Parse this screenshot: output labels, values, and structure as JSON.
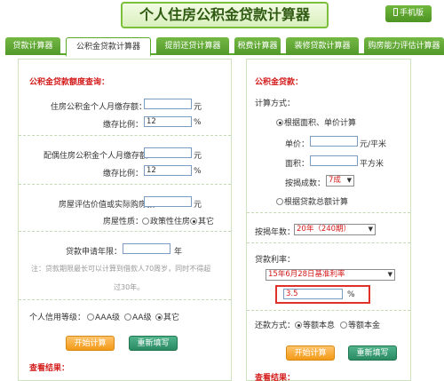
{
  "header": {
    "title": "个人住房公积金贷款计算器",
    "mobile_label": "手机版"
  },
  "tabs": [
    {
      "label": "贷款计算器"
    },
    {
      "label": "公积金贷款计算器"
    },
    {
      "label": "提前还贷计算器"
    },
    {
      "label": "税费计算器"
    },
    {
      "label": "装修贷款计算器"
    },
    {
      "label": "购房能力评估计算器"
    }
  ],
  "left": {
    "section_title": "公积金贷款额度查询：",
    "personal_deposit_label": "住房公积金个人月缴存额：",
    "personal_deposit_value": "",
    "unit_yuan": "元",
    "ratio_label": "缴存比例：",
    "ratio_value": "12",
    "unit_percent": "%",
    "spouse_deposit_label": "配偶住房公积金个人月缴存额：",
    "spouse_deposit_value": "",
    "spouse_ratio_value": "12",
    "house_value_label": "房屋评估价值或实际购房款：",
    "house_value_value": "",
    "house_type_label": "房屋性质：",
    "house_type_options": [
      "政策性住房",
      "其它"
    ],
    "term_label": "贷款申请年限：",
    "term_value": "",
    "term_unit": "年",
    "note_line1": "注：贷款期限最长可以计算到借款人70周岁，同时不得超",
    "note_line2": "过30年。",
    "credit_label": "个人信用等级：",
    "credit_options": [
      "AAA级",
      "AA级",
      "其它"
    ],
    "start_btn": "开始计算",
    "reset_btn": "重新填写",
    "result_title": "查看结果："
  },
  "right": {
    "section_title": "公积金贷款：",
    "calc_method_label": "计算方式：",
    "method_area_label": "根据面积、单价计算",
    "unit_price_label": "单价：",
    "unit_price_value": "",
    "unit_price_unit": "元/平米",
    "area_label": "面积：",
    "area_value": "",
    "area_unit": "平方米",
    "percent_label": "按揭成数：",
    "percent_value": "7成",
    "method_total_label": "根据贷款总额计算",
    "years_label": "按揭年数：",
    "years_value": "20年（240期）",
    "rate_label": "贷款利率：",
    "rate_select": "15年6月28日基准利率",
    "rate_value": "3.5",
    "rate_unit": "%",
    "repay_label": "还款方式：",
    "repay_options": [
      "等额本息",
      "等额本金"
    ],
    "start_btn": "开始计算",
    "reset_btn": "重新填写",
    "result_title": "查看结果："
  },
  "colors": {
    "accent": "#5aa82a",
    "red_label": "#d41a1a",
    "highlight": "#e0302a"
  }
}
